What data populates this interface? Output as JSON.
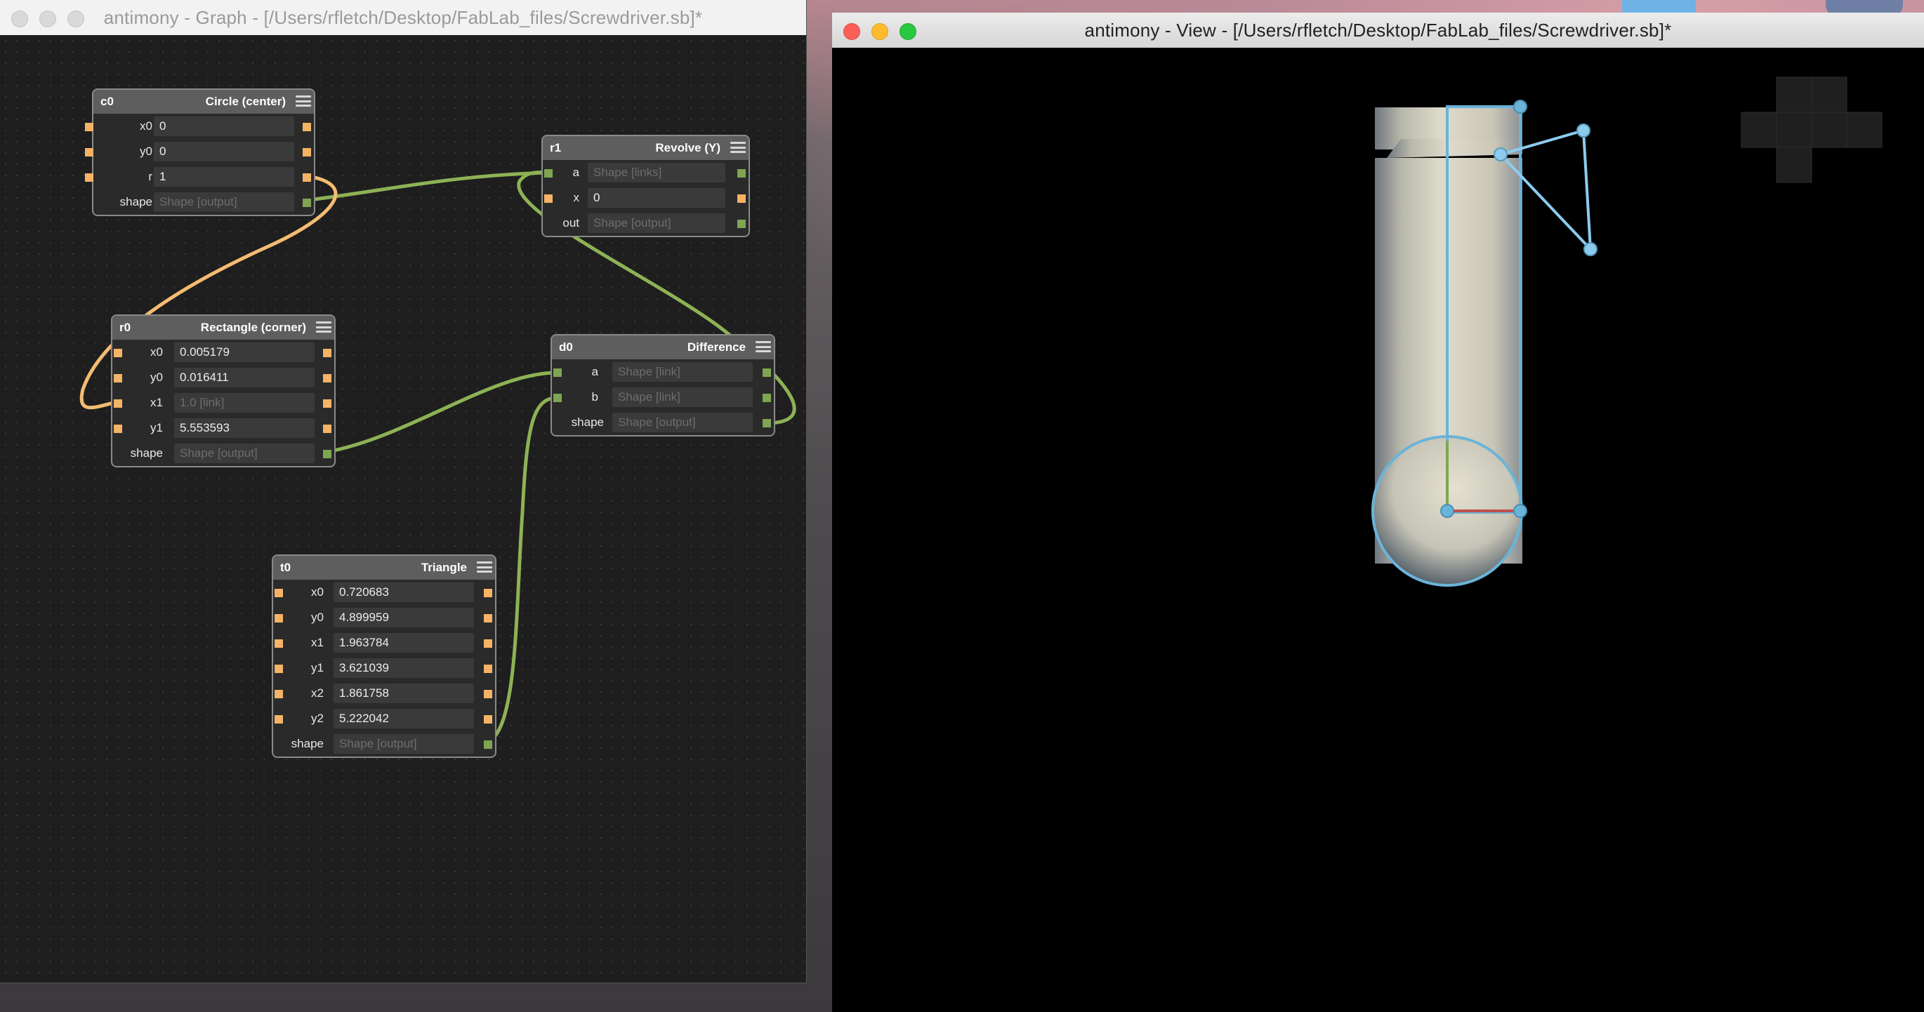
{
  "graph_window": {
    "title": "antimony - Graph - [/Users/rfletch/Desktop/FabLab_files/Screwdriver.sb]*",
    "nodes": {
      "c0": {
        "id": "c0",
        "type": "Circle (center)",
        "rows": [
          {
            "label": "x0",
            "value": "0"
          },
          {
            "label": "y0",
            "value": "0"
          },
          {
            "label": "r",
            "value": "1"
          },
          {
            "label": "shape",
            "value": "Shape [output]"
          }
        ]
      },
      "r1": {
        "id": "r1",
        "type": "Revolve (Y)",
        "rows": [
          {
            "label": "a",
            "value": "Shape [links]"
          },
          {
            "label": "x",
            "value": "0"
          },
          {
            "label": "out",
            "value": "Shape [output]"
          }
        ]
      },
      "r0": {
        "id": "r0",
        "type": "Rectangle (corner)",
        "rows": [
          {
            "label": "x0",
            "value": "0.005179"
          },
          {
            "label": "y0",
            "value": "0.016411"
          },
          {
            "label": "x1",
            "value": "1.0 [link]"
          },
          {
            "label": "y1",
            "value": "5.553593"
          },
          {
            "label": "shape",
            "value": "Shape [output]"
          }
        ]
      },
      "d0": {
        "id": "d0",
        "type": "Difference",
        "rows": [
          {
            "label": "a",
            "value": "Shape [link]"
          },
          {
            "label": "b",
            "value": "Shape [link]"
          },
          {
            "label": "shape",
            "value": "Shape [output]"
          }
        ]
      },
      "t0": {
        "id": "t0",
        "type": "Triangle",
        "rows": [
          {
            "label": "x0",
            "value": "0.720683"
          },
          {
            "label": "y0",
            "value": "4.899959"
          },
          {
            "label": "x1",
            "value": "1.963784"
          },
          {
            "label": "y1",
            "value": "3.621039"
          },
          {
            "label": "x2",
            "value": "1.861758"
          },
          {
            "label": "y2",
            "value": "5.222042"
          },
          {
            "label": "shape",
            "value": "Shape [output]"
          }
        ]
      }
    }
  },
  "view_window": {
    "title": "antimony - View - [/Users/rfletch/Desktop/FabLab_files/Screwdriver.sb]*"
  },
  "colors": {
    "number_port": "#f4b366",
    "shape_port": "#7fa552",
    "shape_wire": "#8db255",
    "number_wire": "#f4bc72",
    "control_handle": "#8ccbee",
    "control_outline": "#6ab4d9",
    "x_axis": "#c0504d",
    "y_axis": "#7fa552"
  },
  "icons": [
    "menu-icon",
    "close-dot",
    "minimize-dot",
    "maximize-dot",
    "view-axis-cross-icon"
  ]
}
